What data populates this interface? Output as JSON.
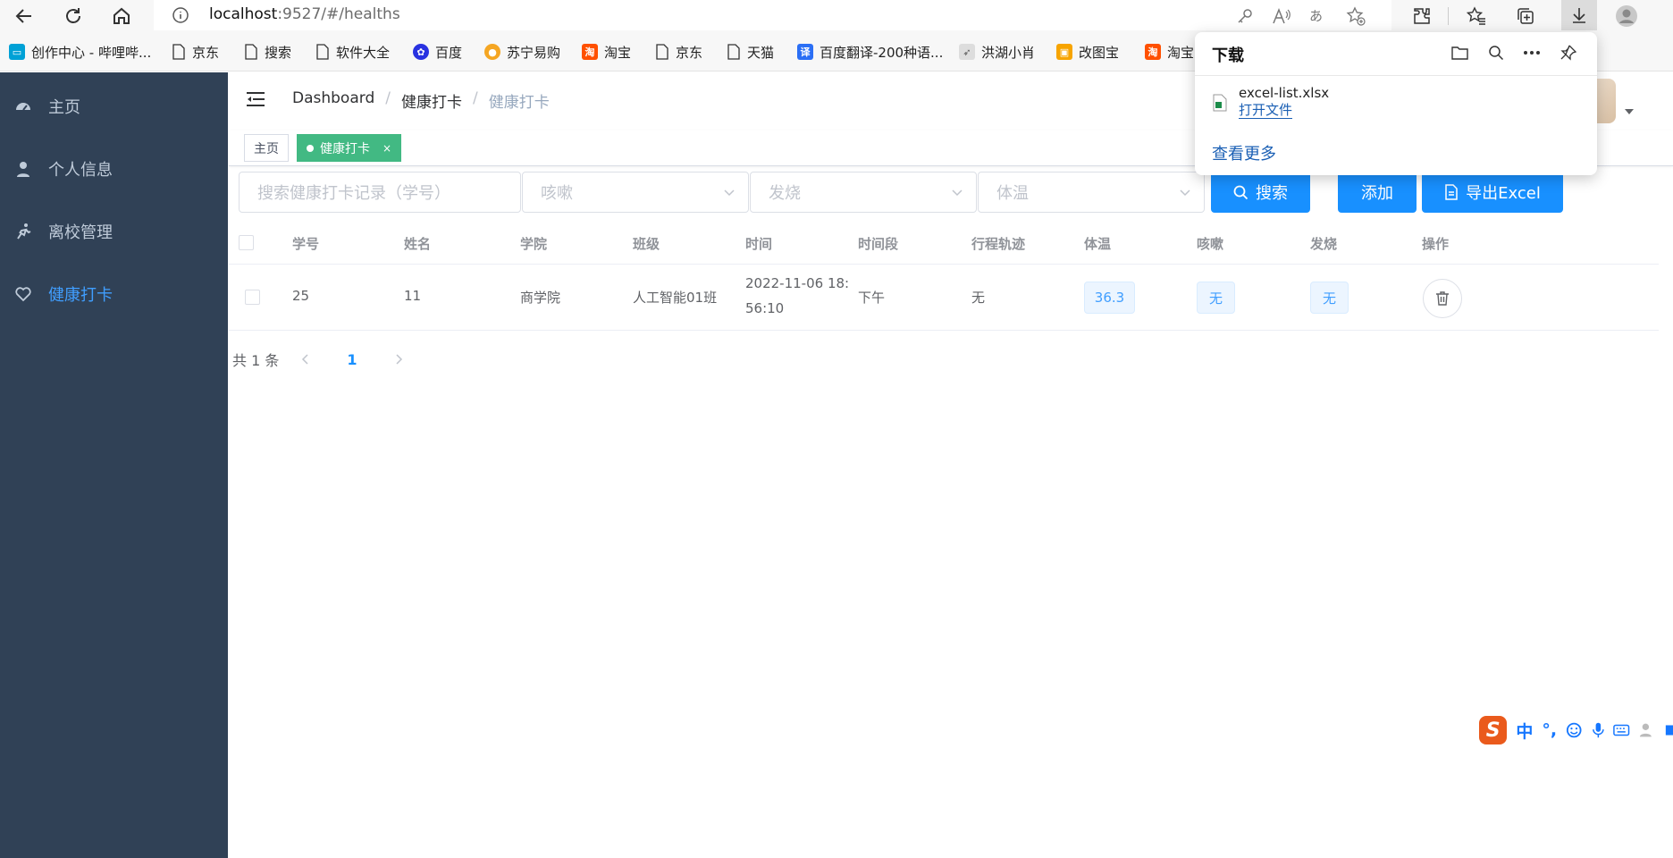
{
  "browser": {
    "url_host": "localhost",
    "url_path": ":9527/#/healths"
  },
  "bookmarks": [
    {
      "label": "创作中心 - 哔哩哔...",
      "icon": "bilibili-icon",
      "color": "#00a1d6"
    },
    {
      "label": "京东",
      "icon": "page-icon"
    },
    {
      "label": "搜索",
      "icon": "page-icon"
    },
    {
      "label": "软件大全",
      "icon": "page-icon"
    },
    {
      "label": "百度",
      "icon": "baidu-icon",
      "color": "#2932e1"
    },
    {
      "label": "苏宁易购",
      "icon": "suning-icon",
      "color": "#f5a623"
    },
    {
      "label": "淘宝",
      "icon": "taobao-icon",
      "color": "#ff5000"
    },
    {
      "label": "京东",
      "icon": "page-icon"
    },
    {
      "label": "天猫",
      "icon": "page-icon"
    },
    {
      "label": "百度翻译-200种语...",
      "icon": "translate-icon",
      "color": "#2b6ff5"
    },
    {
      "label": "洪湖小肖",
      "icon": "bird-icon"
    },
    {
      "label": "改图宝",
      "icon": "gaitubao-icon",
      "color": "#f7a400"
    },
    {
      "label": "淘宝",
      "icon": "taobao-icon",
      "color": "#ff5000"
    }
  ],
  "sidebar": {
    "items": [
      {
        "label": "主页",
        "icon": "dashboard-icon"
      },
      {
        "label": "个人信息",
        "icon": "user-icon"
      },
      {
        "label": "离校管理",
        "icon": "run-icon"
      },
      {
        "label": "健康打卡",
        "icon": "heart-icon",
        "active": true
      }
    ]
  },
  "breadcrumb": [
    "Dashboard",
    "健康打卡",
    "健康打卡"
  ],
  "tags": {
    "home": "主页",
    "current": "健康打卡",
    "close": "×"
  },
  "filters": {
    "search_placeholder": "搜索健康打卡记录（学号）",
    "cough_placeholder": "咳嗽",
    "fever_placeholder": "发烧",
    "temp_placeholder": "体温",
    "search_button": "搜索",
    "add_button": "添加",
    "export_button": "导出Excel"
  },
  "table": {
    "columns": [
      "学号",
      "姓名",
      "学院",
      "班级",
      "时间",
      "时间段",
      "行程轨迹",
      "体温",
      "咳嗽",
      "发烧",
      "操作"
    ],
    "rows": [
      {
        "student_id": "25",
        "name": "11",
        "college": "商学院",
        "class": "人工智能01班",
        "time_line1": "2022-11-06 18:",
        "time_line2": "56:10",
        "period": "下午",
        "trace": "无",
        "temperature": "36.3",
        "cough": "无",
        "fever": "无"
      }
    ]
  },
  "pagination": {
    "total": "共 1 条",
    "current": "1"
  },
  "downloads": {
    "title": "下载",
    "file_name": "excel-list.xlsx",
    "open_file": "打开文件",
    "see_more": "查看更多"
  },
  "ime": {
    "mode": "中",
    "punct": "°,"
  },
  "colors": {
    "sidebar_bg": "#304156",
    "active": "#409eff",
    "primary_button": "#1890ff",
    "tag_active": "#42b983"
  }
}
